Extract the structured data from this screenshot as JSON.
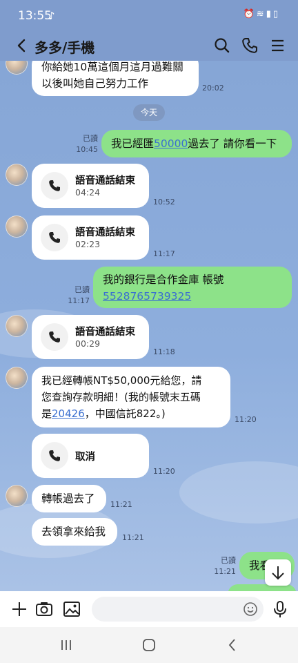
{
  "status": {
    "time": "13:55"
  },
  "header": {
    "title": "多多/手機"
  },
  "date_divider": "今天",
  "messages": {
    "m0": {
      "lines": [
        "你給她10萬這個月這月過難關",
        "以後叫她自己努力工作"
      ],
      "time": "20:02"
    },
    "m1": {
      "read": "已讀",
      "time": "10:45",
      "pre": "我已經匯",
      "link": "50000",
      "post": "過去了 請你看一下"
    },
    "m2": {
      "title": "語音通話結束",
      "duration": "04:24",
      "time": "10:52"
    },
    "m3": {
      "title": "語音通話結束",
      "duration": "02:23",
      "time": "11:17"
    },
    "m4": {
      "read": "已讀",
      "time": "11:17",
      "line1": "我的銀行是合作金庫 帳號",
      "link": "5528765739325"
    },
    "m5": {
      "title": "語音通話結束",
      "duration": "00:29",
      "time": "11:18"
    },
    "m6": {
      "line1": "我已經轉帳NT$50,000元給您，請",
      "line2": "您查詢存款明細！(我的帳號末五碼",
      "pre3": "是",
      "link": "20426",
      "post3": "，中國信託822。)",
      "time": "11:20"
    },
    "m7": {
      "label": "取消",
      "time": "11:20"
    },
    "m8": {
      "text": "轉帳過去了",
      "time": "11:21"
    },
    "m9": {
      "text": "去領拿來給我",
      "time": "11:21"
    },
    "m10": {
      "read": "已讀",
      "time": "11:21",
      "text": "我看"
    }
  },
  "input": {
    "placeholder": ""
  },
  "colors": {
    "bubble_out": "#8de289",
    "bubble_in": "#ffffff",
    "link": "#3a6fd0",
    "chat_bg": "#88a8d8"
  }
}
